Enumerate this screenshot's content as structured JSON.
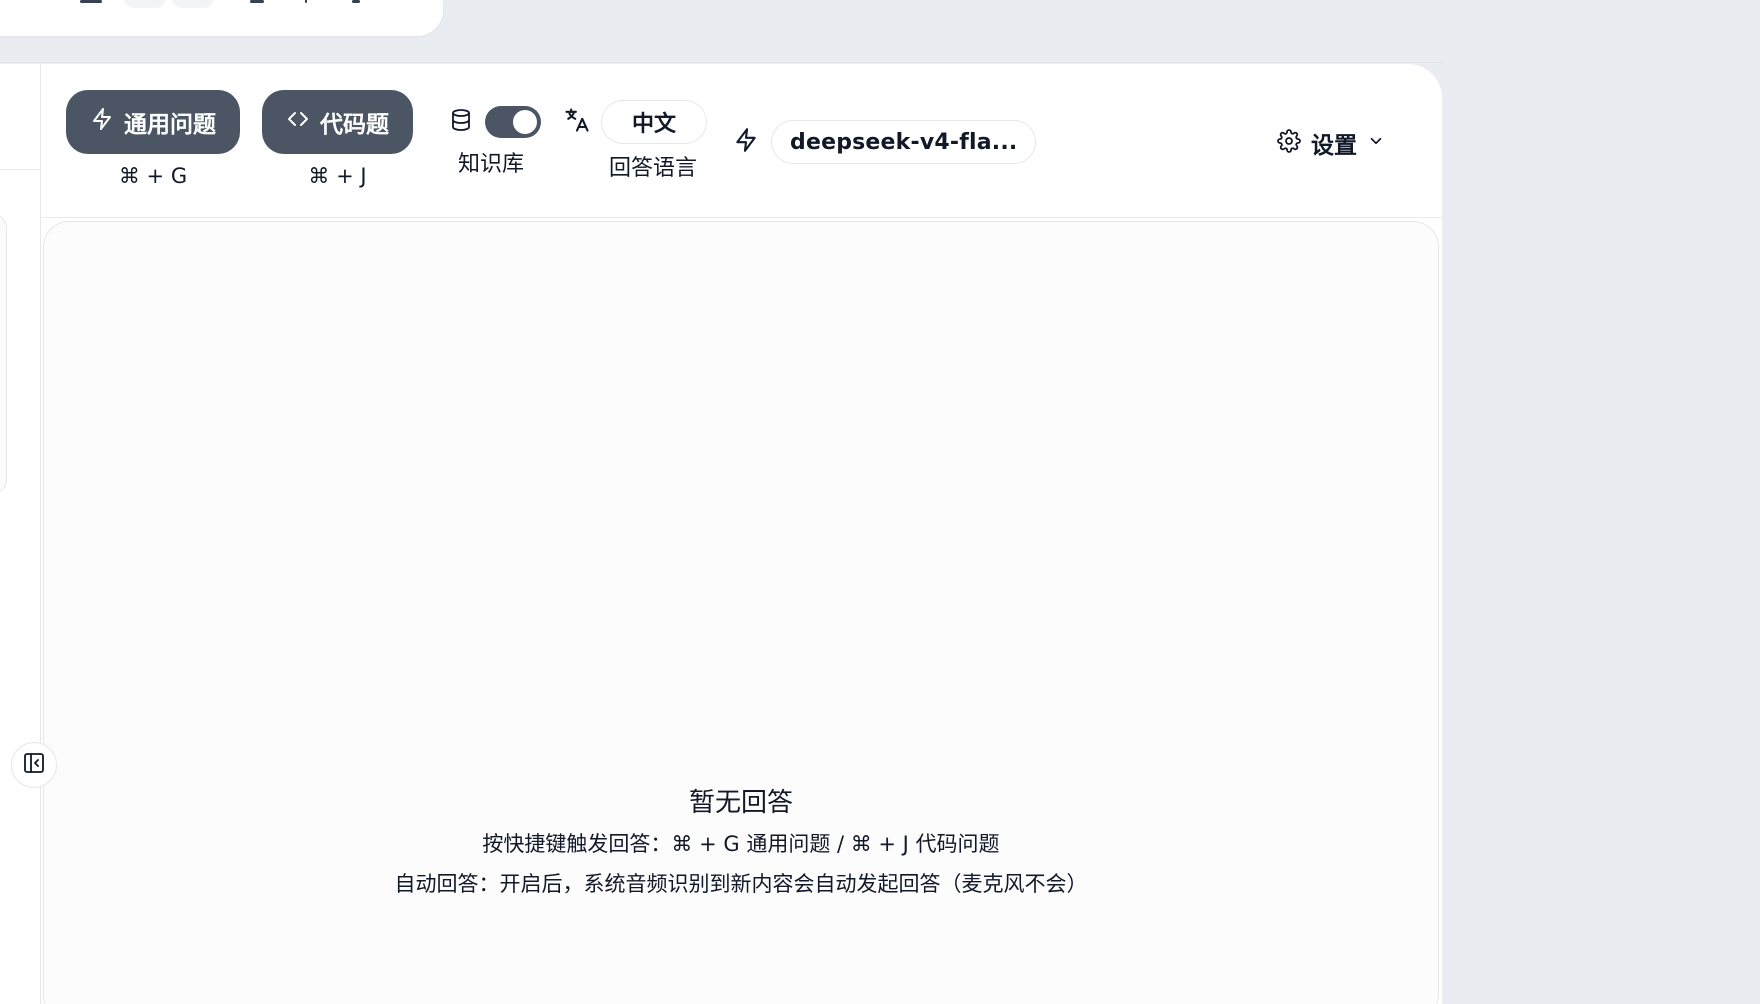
{
  "toolbar": {
    "general_button": {
      "label": "通用问题",
      "shortcut": "⌘ + G",
      "icon": "bolt-icon"
    },
    "code_button": {
      "label": "代码题",
      "shortcut": "⌘ + J",
      "icon": "code-icon"
    },
    "knowledge_base": {
      "label": "知识库",
      "enabled": true,
      "icon": "database-icon"
    },
    "answer_language": {
      "label": "回答语言",
      "value": "中文",
      "icon": "translate-icon"
    },
    "model": {
      "value": "deepseek-v4-fla...",
      "icon": "bolt-icon"
    },
    "settings": {
      "label": "设置",
      "icon": "gear-icon"
    }
  },
  "answer": {
    "empty_title": "暂无回答",
    "hint_shortcuts": "按快捷键触发回答：⌘ + G 通用问题 / ⌘ + J 代码问题",
    "hint_auto": "自动回答：开启后，系统音频识别到新内容会自动发起回答（麦克风不会）"
  },
  "colors": {
    "background": "#e9ecf1",
    "button_dark": "#4b5563",
    "panel": "#ffffff",
    "answer_bg": "#fcfcfd"
  }
}
